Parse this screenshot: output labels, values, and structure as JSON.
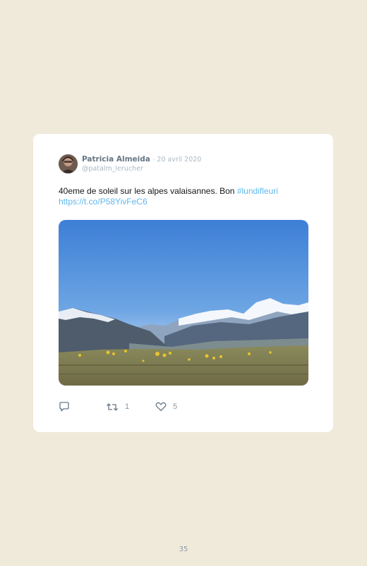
{
  "tweet": {
    "author_name": "Patricia Almeida",
    "separator": "·",
    "date": "20 avril 2020",
    "handle": "@patalm_lerucher",
    "text": "40eme de soleil sur les alpes valaisannes. Bon ",
    "hashtag": "#lundifleuri",
    "url": "https://t.co/P58YivFeC6",
    "photo_icon": "mountain-landscape-photo",
    "actions": {
      "reply_icon": "comment-icon",
      "retweet_icon": "retweet-icon",
      "retweet_count": "1",
      "like_icon": "heart-icon",
      "like_count": "5"
    }
  },
  "page_number": "35"
}
